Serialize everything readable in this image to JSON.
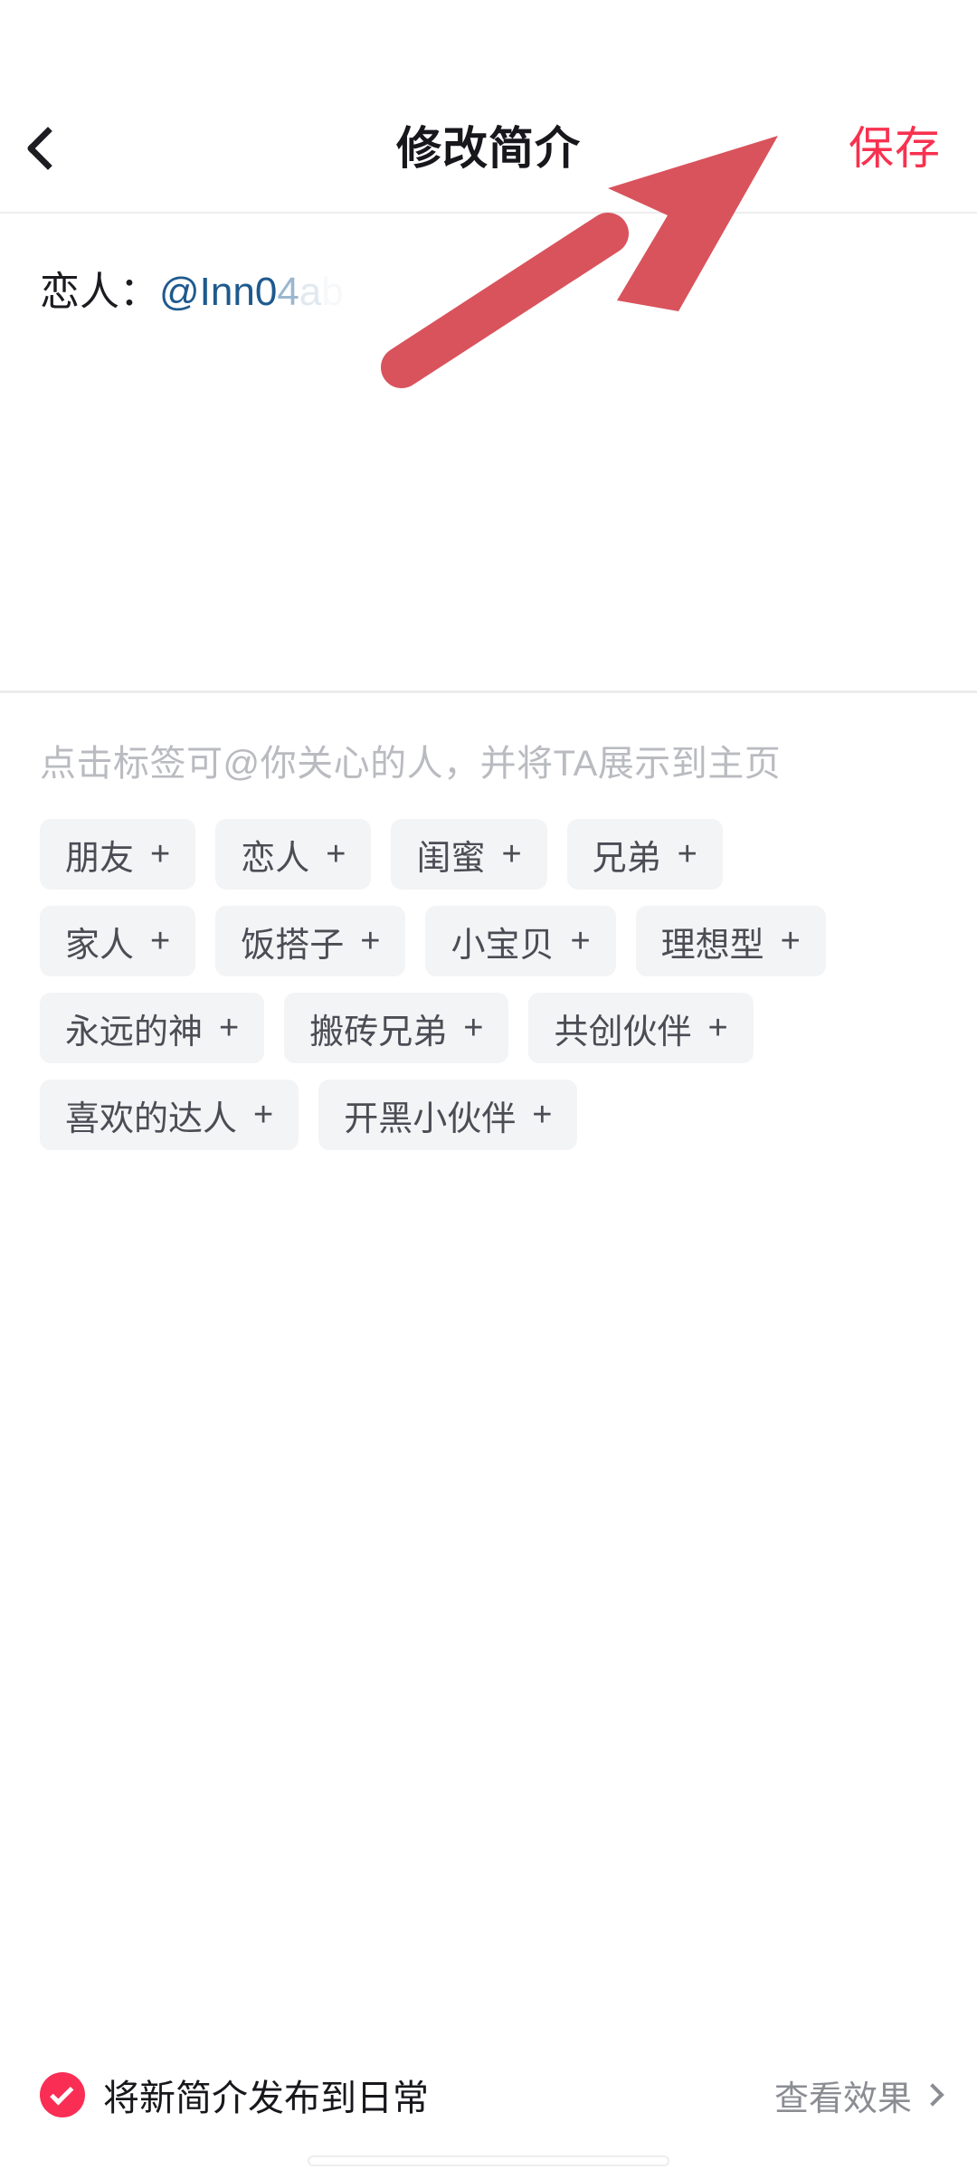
{
  "header": {
    "back_icon": "chevron-left-icon",
    "title": "修改简介",
    "save_label": "保存",
    "save_color": "#f8314f"
  },
  "bio": {
    "prefix": "恋人：",
    "mention_visible": "@Inn0",
    "mention_fade1": "4",
    "mention_fade2": "a",
    "mention_fade3": "b",
    "mention_color": "#1e5a8e"
  },
  "tag_picker": {
    "hint": "点击标签可@你关心的人，并将TA展示到主页",
    "plus_glyph": "+",
    "rows": [
      [
        {
          "label": "朋友"
        },
        {
          "label": "恋人"
        },
        {
          "label": "闺蜜"
        },
        {
          "label": "兄弟"
        }
      ],
      [
        {
          "label": "家人"
        },
        {
          "label": "饭搭子"
        },
        {
          "label": "小宝贝"
        },
        {
          "label": "理想型"
        }
      ],
      [
        {
          "label": "永远的神"
        },
        {
          "label": "搬砖兄弟"
        },
        {
          "label": "共创伙伴"
        }
      ],
      [
        {
          "label": "喜欢的达人"
        },
        {
          "label": "开黑小伙伴"
        }
      ]
    ]
  },
  "bottom_bar": {
    "checkbox_checked": true,
    "checkbox_color": "#fa2e55",
    "checkbox_icon": "check-icon",
    "label": "将新简介发布到日常",
    "preview_label": "查看效果",
    "preview_chevron": "chevron-right-icon"
  },
  "annotation": {
    "arrow_icon": "arrow-up-right-icon",
    "arrow_color": "#d9535c"
  }
}
